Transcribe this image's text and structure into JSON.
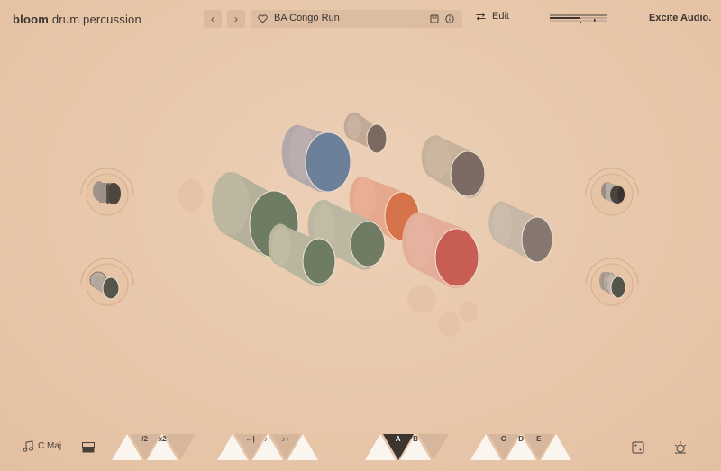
{
  "header": {
    "brand_bold": "bloom",
    "brand_rest": "drum percussion",
    "prev_icon": "chevron-left-icon",
    "next_icon": "chevron-right-icon",
    "preset_name": "BA Congo Run",
    "favorite_icon": "heart-icon",
    "save_icon": "save-icon",
    "info_icon": "info-icon",
    "edit_label": "Edit",
    "edit_icon": "swap-arrows-icon",
    "company": "Excite Audio."
  },
  "footer": {
    "scale_label": "C Maj",
    "scale_icon": "music-note-icon",
    "layout_icon": "layout-icon",
    "random_icon": "dice-icon",
    "settings_icon": "sun-gear-icon",
    "groups": [
      [
        "",
        "/2",
        "x2",
        ""
      ],
      [
        "",
        "←|",
        "♪−",
        "♪+",
        ""
      ],
      [
        "",
        "A",
        "B",
        ""
      ],
      [
        "",
        "C",
        "D",
        "E",
        ""
      ]
    ],
    "active_pattern": "A"
  },
  "colors": {
    "background": "#e8c7aa",
    "accent_orange": "#d7734a",
    "accent_red": "#c75d53",
    "accent_blue": "#6c809a",
    "accent_green": "#6e7c63"
  }
}
